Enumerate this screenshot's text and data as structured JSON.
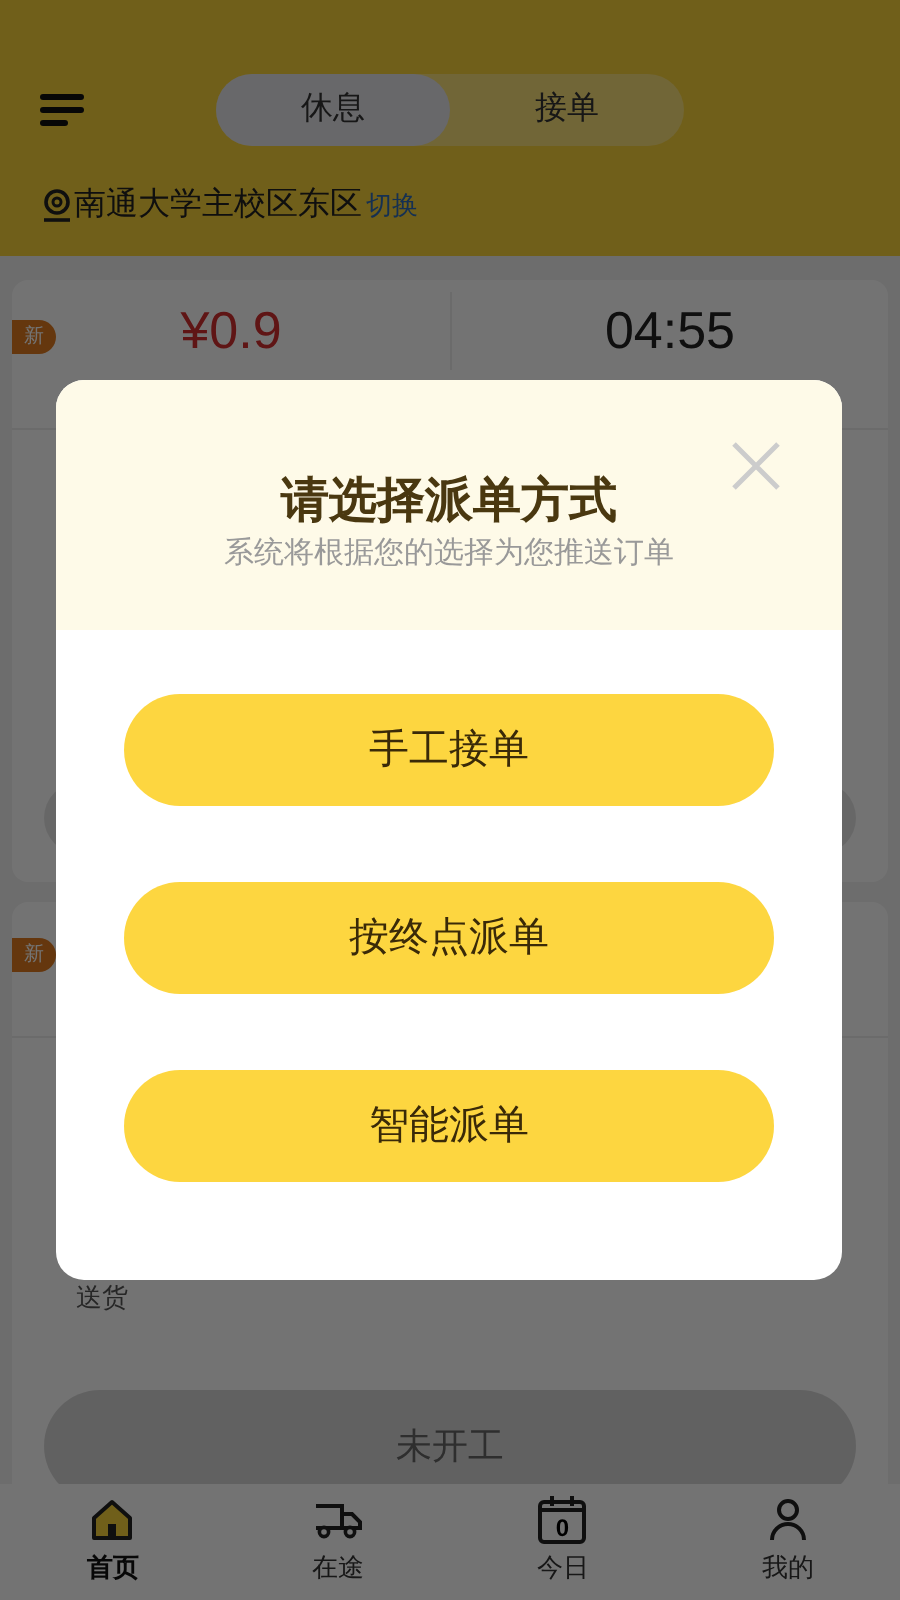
{
  "header": {
    "mode_tabs": [
      {
        "label": "休息",
        "selected": true
      },
      {
        "label": "接单",
        "selected": false
      }
    ],
    "location": "南通大学主校区东区",
    "switch_link": "切换"
  },
  "orders": [
    {
      "badge": "新",
      "price": "¥0.9",
      "time": "04:55"
    },
    {
      "badge": "新",
      "note": "送货"
    }
  ],
  "start_button": "未开工",
  "dialog": {
    "title": "请选择派单方式",
    "subtitle": "系统将根据您的选择为您推送订单",
    "options": [
      "手工接单",
      "按终点派单",
      "智能派单"
    ]
  },
  "nav": [
    {
      "label": "首页",
      "kind": "home",
      "selected": true
    },
    {
      "label": "在途",
      "kind": "truck",
      "selected": false
    },
    {
      "label": "今日",
      "kind": "calendar",
      "selected": false,
      "icon_text": "0"
    },
    {
      "label": "我的",
      "kind": "user",
      "selected": false
    }
  ]
}
